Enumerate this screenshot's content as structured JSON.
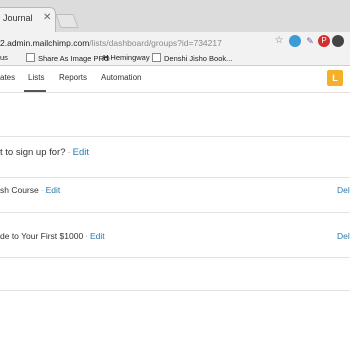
{
  "browser": {
    "tab_title": "Journal",
    "url_host": "2.admin.mailchimp.com",
    "url_path": "/lists/dashboard/groups?id=734217"
  },
  "bookmarks": [
    {
      "label": "us"
    },
    {
      "label": "Share As Image PRO"
    },
    {
      "label": "Hemingway"
    },
    {
      "label": "Denshi Jisho Book..."
    }
  ],
  "nav": {
    "items": [
      "ates",
      "Lists",
      "Reports",
      "Automation"
    ],
    "avatar": "L"
  },
  "content": {
    "question": "t to sign up for?",
    "question_edit": "Edit",
    "rows": [
      {
        "label": "sh Course",
        "edit": "Edit",
        "delete": "Dele"
      },
      {
        "label": "de to Your First $1000",
        "edit": "Edit",
        "delete": "Dele"
      }
    ]
  },
  "colors": {
    "link": "#2a7ab0",
    "avatar": "#f4b02a"
  }
}
